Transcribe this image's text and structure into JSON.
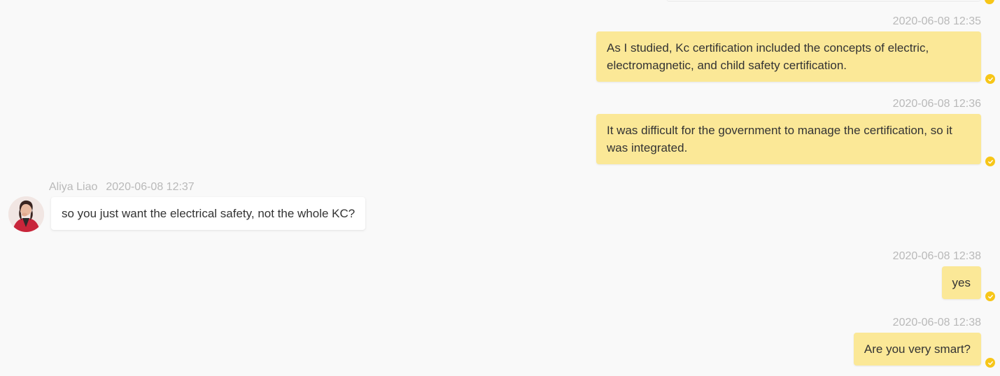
{
  "conversation": {
    "messages": [
      {
        "direction": "outgoing",
        "time": "2020-06-08 12:35",
        "text": "As I studied, Kc certification included the concepts of electric, electromagnetic, and child safety certification.",
        "status": "read"
      },
      {
        "direction": "outgoing",
        "time": "2020-06-08 12:36",
        "text": "It was difficult for the government to manage the certification, so it was integrated.",
        "status": "read"
      },
      {
        "direction": "incoming",
        "sender": "Aliya Liao",
        "time": "2020-06-08 12:37",
        "text": "so you just want the electrical safety, not the whole KC?"
      },
      {
        "direction": "outgoing",
        "time": "2020-06-08 12:38",
        "text": "yes",
        "status": "read"
      },
      {
        "direction": "outgoing",
        "time": "2020-06-08 12:38",
        "text": "Are you very smart?",
        "status": "read"
      }
    ]
  },
  "icons": {
    "read_status": "check-circle-icon",
    "avatar": "user-avatar"
  },
  "colors": {
    "background": "#f9f9f9",
    "outgoing_bubble": "#fbe897",
    "incoming_bubble": "#ffffff",
    "read_check": "#f7c618",
    "timestamp": "#b9b9b9",
    "text": "#333333"
  }
}
